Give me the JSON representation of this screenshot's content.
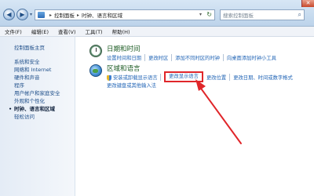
{
  "window": {
    "close_glyph": "✕"
  },
  "address": {
    "crumbs": [
      "控制面板",
      "时钟、语言和区域"
    ],
    "search_placeholder": "搜索控制面板"
  },
  "menu": [
    "文件(F)",
    "编辑(E)",
    "查看(V)",
    "工具(T)",
    "帮助(H)"
  ],
  "sidebar": {
    "home": "控制面板主页",
    "items": [
      {
        "label": "系统和安全",
        "active": false
      },
      {
        "label": "网络和 Internet",
        "active": false
      },
      {
        "label": "硬件和声音",
        "active": false
      },
      {
        "label": "程序",
        "active": false
      },
      {
        "label": "用户帐户和家庭安全",
        "active": false
      },
      {
        "label": "外观和个性化",
        "active": false
      },
      {
        "label": "时钟、语言和区域",
        "active": true
      },
      {
        "label": "轻松访问",
        "active": false
      }
    ]
  },
  "categories": {
    "datetime": {
      "title": "日期和时间",
      "links": [
        "设置时间和日期",
        "更改时区",
        "添加不同时区的时钟",
        "向桌面添加时钟小工具"
      ]
    },
    "region": {
      "title": "区域和语言",
      "links_row1": [
        "安装或卸载显示语言",
        "更改显示语言",
        "更改位置",
        "更改日期、时间或数字格式"
      ],
      "links_row2": [
        "更改键盘或其他输入法"
      ]
    }
  },
  "annotation": {
    "color": "#e0262a"
  }
}
